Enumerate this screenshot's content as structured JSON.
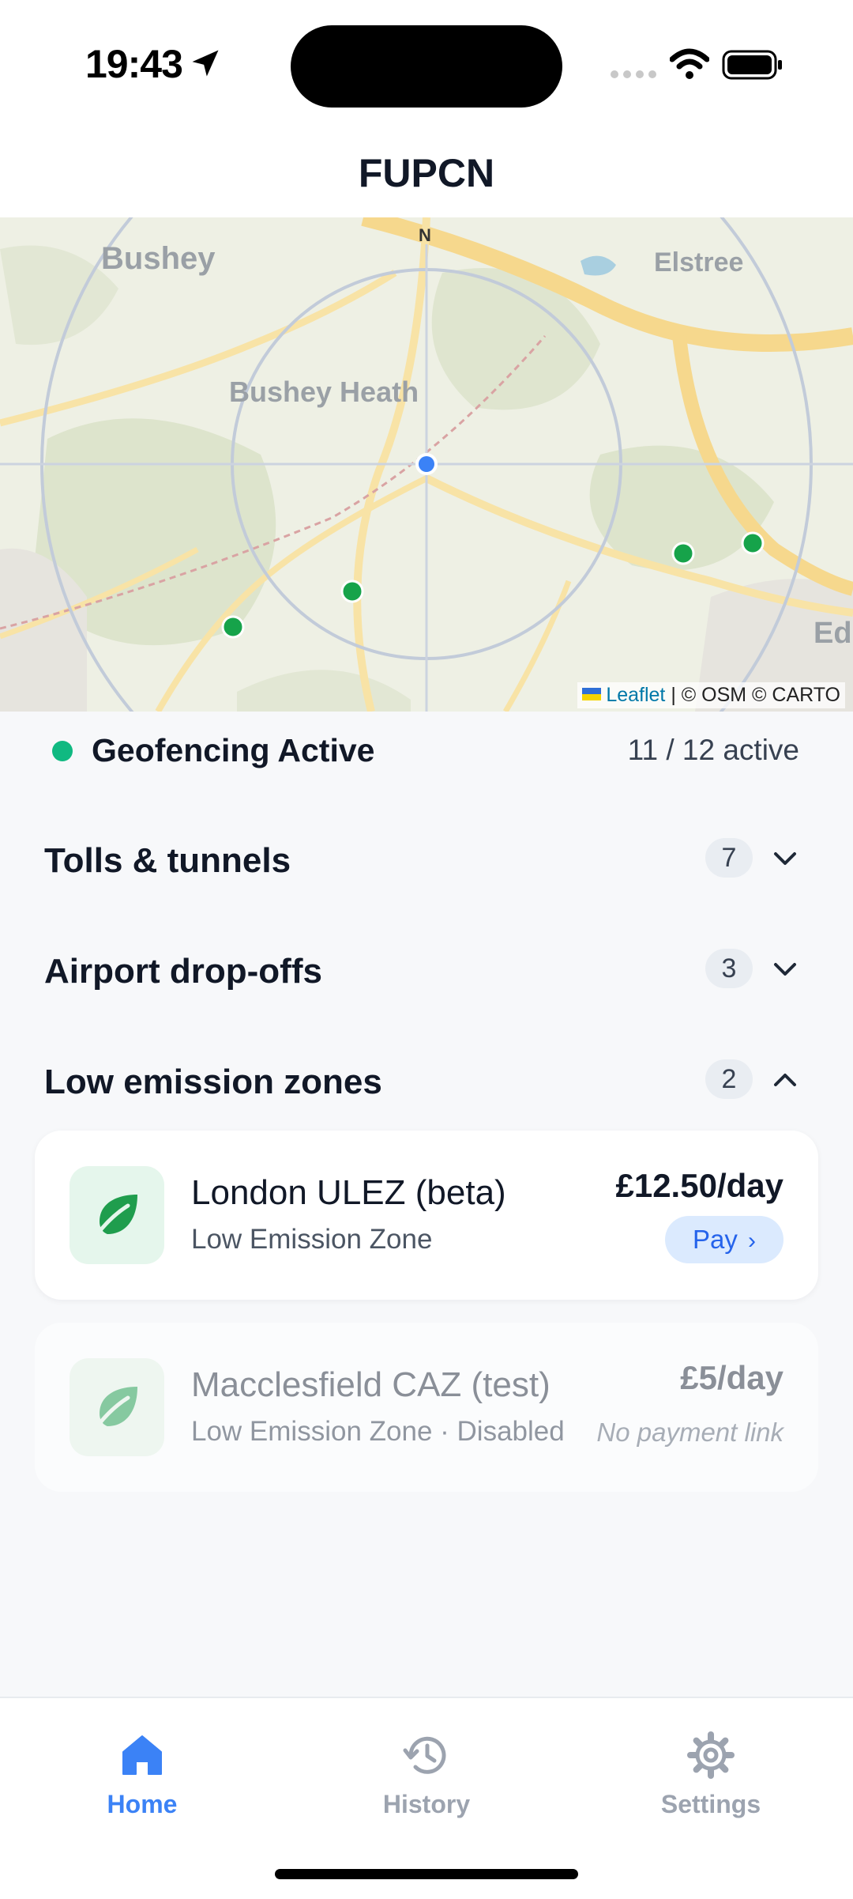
{
  "status_bar": {
    "time": "19:43"
  },
  "header": {
    "title": "FUPCN"
  },
  "map": {
    "compass": "N",
    "place_labels": [
      "Bushey",
      "Elstree",
      "Bushey Heath",
      "Ed"
    ],
    "attribution_link": "Leaflet",
    "attribution_text": "| © OSM © CARTO",
    "user_location_color": "#3b82f6",
    "zone_marker_color": "#16a34a"
  },
  "geofence": {
    "label": "Geofencing Active",
    "count": "11 / 12 active",
    "status_color": "#10b981"
  },
  "sections": [
    {
      "title": "Tolls & tunnels",
      "count": "7",
      "expanded": false
    },
    {
      "title": "Airport drop-offs",
      "count": "3",
      "expanded": false
    },
    {
      "title": "Low emission zones",
      "count": "2",
      "expanded": true
    }
  ],
  "zones": [
    {
      "name": "London ULEZ (beta)",
      "subtitle": "Low Emission Zone",
      "price": "£12.50/day",
      "action": "Pay",
      "icon": "leaf-icon"
    },
    {
      "name": "Macclesfield CAZ (test)",
      "subtitle": "Low Emission Zone · Disabled",
      "price": "£5/day",
      "note": "No payment link",
      "icon": "leaf-icon"
    }
  ],
  "tabs": [
    {
      "label": "Home",
      "icon": "home-icon",
      "active": true
    },
    {
      "label": "History",
      "icon": "history-icon",
      "active": false
    },
    {
      "label": "Settings",
      "icon": "gear-icon",
      "active": false
    }
  ],
  "colors": {
    "accent": "#3b82f6",
    "leaf": "#1f9d4d",
    "pay_bg": "#dbeafe"
  }
}
